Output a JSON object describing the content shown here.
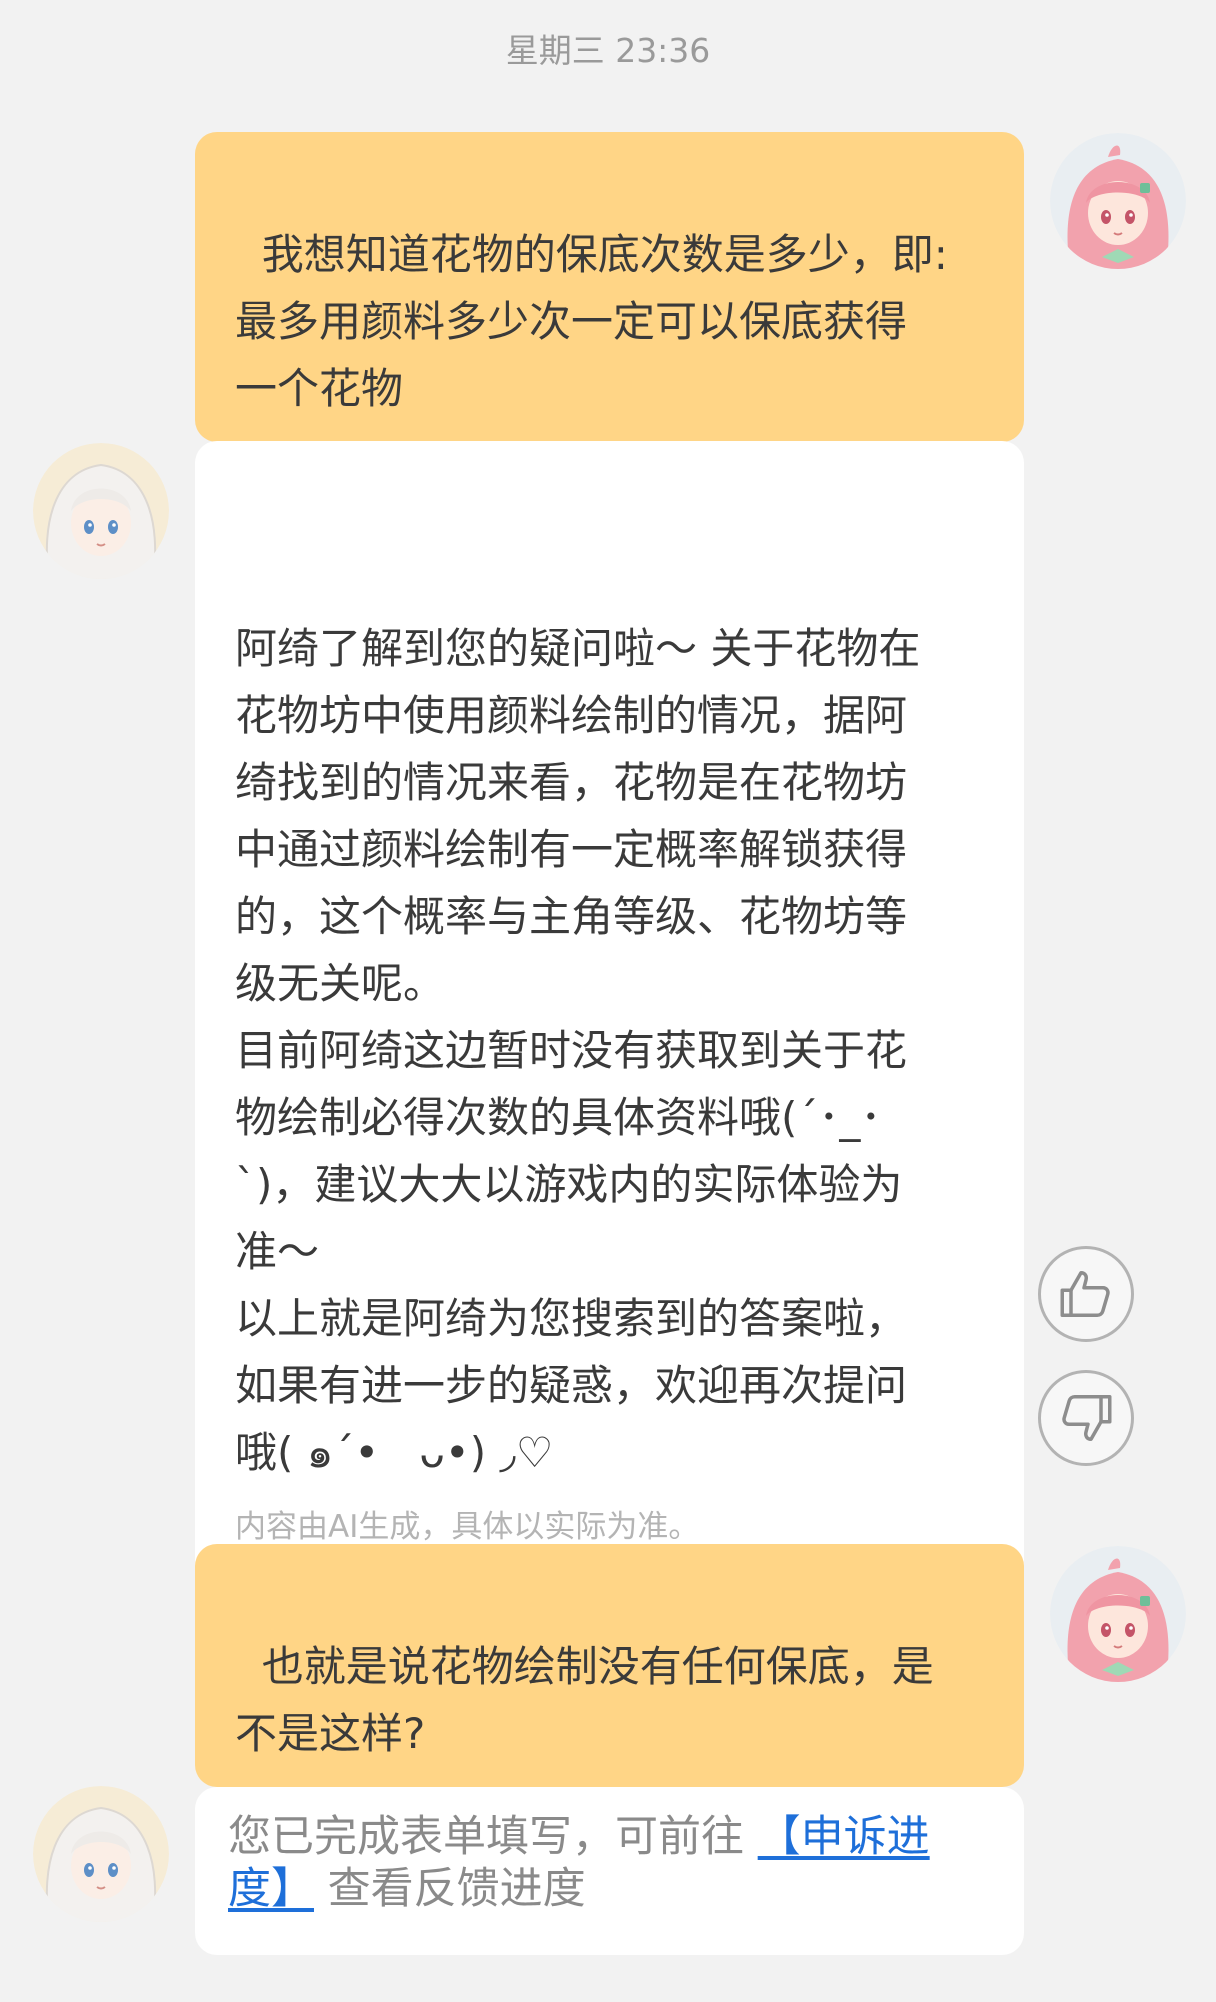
{
  "chat": {
    "timestamp": "星期三 23:36",
    "messages": [
      {
        "role": "user",
        "text": "我想知道花物的保底次数是多少，即:\n最多用颜料多少次一定可以保底获得\n一个花物"
      },
      {
        "role": "bot",
        "paragraphs": [
          "阿绮了解到您的疑问啦～ 关于花物在\n花物坊中使用颜料绘制的情况，据阿\n绮找到的情况来看，花物是在花物坊\n中通过颜料绘制有一定概率解锁获得\n的，这个概率与主角等级、花物坊等\n级无关呢。",
          "目前阿绮这边暂时没有获取到关于花\n物绘制必得次数的具体资料哦(´･_･\n`)，建议大大以游戏内的实际体验为\n准～",
          "以上就是阿绮为您搜索到的答案啦，\n如果有进一步的疑惑，欢迎再次提问\n哦( ๑´•   ᴗ•) ◞♡"
        ],
        "disclaimer": "内容由AI生成，具体以实际为准。"
      },
      {
        "role": "user",
        "text": "也就是说花物绘制没有任何保底，是\n不是这样?"
      }
    ],
    "notice": {
      "prefix": "您已完成表单填写，可前往 ",
      "link": "【申诉进度】",
      "suffix": " 查看反馈进度"
    },
    "feedback": {
      "like_icon": "thumbs-up-icon",
      "dislike_icon": "thumbs-down-icon"
    }
  },
  "colors": {
    "page_background": "#f2f2f2",
    "user_bubble": "#ffd586",
    "bot_bubble": "#ffffff",
    "link": "#1e6fd9",
    "disclaimer": "#b4b4b4"
  }
}
